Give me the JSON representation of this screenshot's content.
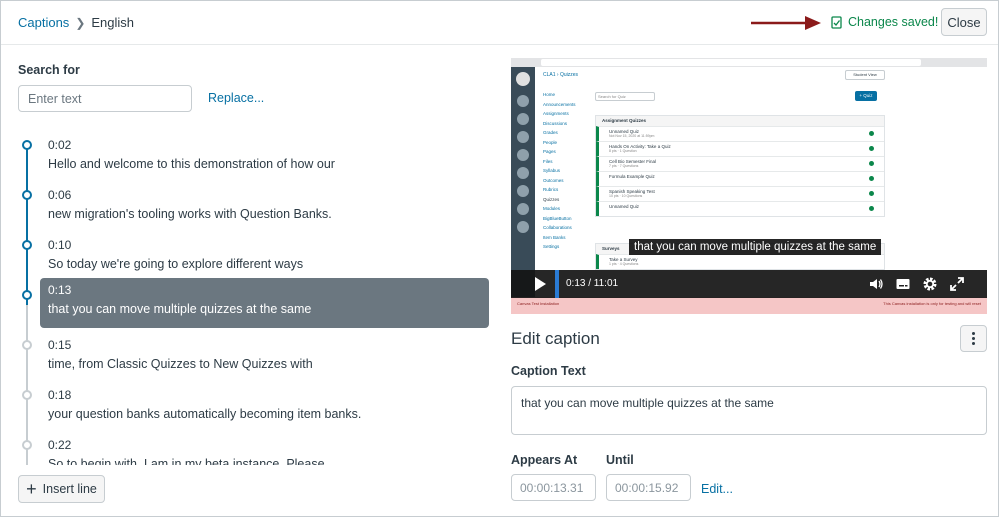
{
  "header": {
    "breadcrumb_root": "Captions",
    "breadcrumb_current": "English",
    "status": "Changes saved!",
    "close_label": "Close",
    "colors": {
      "accent": "#0770a3",
      "success": "#0b874b",
      "arrow": "#8b1a1a"
    }
  },
  "search": {
    "label": "Search for",
    "placeholder": "Enter text",
    "replace_label": "Replace..."
  },
  "captions": [
    {
      "time": "0:02",
      "text": "Hello and welcome to this demonstration of how our",
      "state": "past"
    },
    {
      "time": "0:06",
      "text": "new migration's tooling works with Question Banks.",
      "state": "past"
    },
    {
      "time": "0:10",
      "text": "So today we're going to explore different ways",
      "state": "past"
    },
    {
      "time": "0:13",
      "text": "that you can move multiple quizzes at the same",
      "state": "active"
    },
    {
      "time": "0:15",
      "text": "time, from Classic Quizzes to New Quizzes with",
      "state": "future"
    },
    {
      "time": "0:18",
      "text": "your question banks automatically becoming item banks.",
      "state": "future"
    },
    {
      "time": "0:22",
      "text": "So to begin with, I am in my beta instance. Please",
      "state": "future"
    }
  ],
  "insert_line_label": "Insert line",
  "video": {
    "caption_overlay": "that you can move multiple quizzes at the same",
    "time": "0:13 / 11:01",
    "inner": {
      "crumb": "CLA1 › Quizzes",
      "student_view": "Student View",
      "search_placeholder": "Search for Quiz",
      "add_quiz": "+ Quiz",
      "nav": [
        "Home",
        "Announcements",
        "Assignments",
        "Discussions",
        "Grades",
        "People",
        "Pages",
        "Files",
        "Syllabus",
        "Outcomes",
        "Rubrics",
        "Quizzes",
        "Modules",
        "BigBlueButton",
        "Collaborations",
        "Item Banks",
        "Settings"
      ],
      "group1_title": "Assignment Quizzes",
      "group1_items": [
        {
          "name": "Unnamed Quiz",
          "sub": "Not Nov 15, 2020 at 11:59pm"
        },
        {
          "name": "Hands On Activity: Take a Quiz",
          "sub": "8 pts · 1 Question"
        },
        {
          "name": "Cell Bio Semester Final",
          "sub": "7 pts · 7 Questions"
        },
        {
          "name": "Formula Example Quiz",
          "sub": ""
        },
        {
          "name": "Spanish Speaking Test",
          "sub": "10 pts · 10 Questions"
        },
        {
          "name": "Unnamed Quiz",
          "sub": ""
        }
      ],
      "group2_title": "Surveys",
      "group2_items": [
        {
          "name": "Take a Survey",
          "sub": "1 pts · 4 Questions"
        }
      ],
      "footer": "Canvas Test Installation",
      "footer_right": "This Canvas installation is only for testing and will reset"
    }
  },
  "edit": {
    "title": "Edit caption",
    "caption_label": "Caption Text",
    "caption_value": "that you can move multiple quizzes at the same",
    "appears_label": "Appears At",
    "appears_value": "00:00:13.31",
    "until_label": "Until",
    "until_value": "00:00:15.92",
    "edit_link": "Edit..."
  }
}
